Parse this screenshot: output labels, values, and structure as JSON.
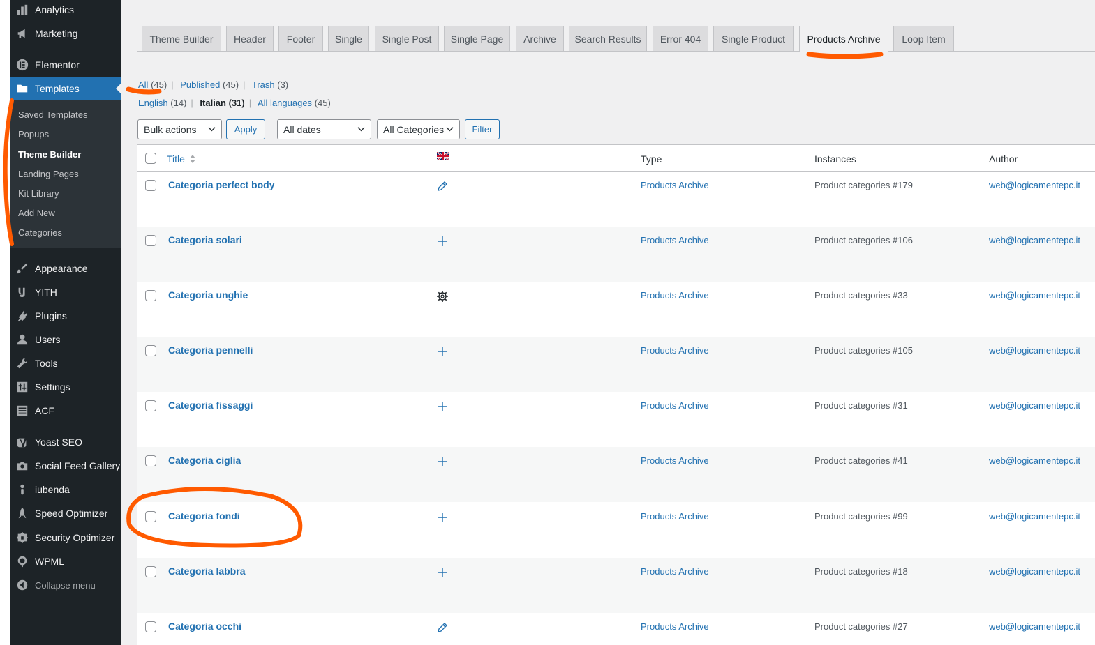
{
  "sidebar": {
    "items": [
      {
        "label": "Analytics",
        "icon": "bar-chart-icon"
      },
      {
        "label": "Marketing",
        "icon": "megaphone-icon"
      },
      {
        "label": "Elementor",
        "icon": "elementor-icon"
      },
      {
        "label": "Templates",
        "icon": "folder-icon"
      },
      {
        "label": "Appearance",
        "icon": "paintbrush-icon"
      },
      {
        "label": "YITH",
        "icon": "yith-icon"
      },
      {
        "label": "Plugins",
        "icon": "plug-icon"
      },
      {
        "label": "Users",
        "icon": "user-icon"
      },
      {
        "label": "Tools",
        "icon": "wrench-icon"
      },
      {
        "label": "Settings",
        "icon": "sliders-icon"
      },
      {
        "label": "ACF",
        "icon": "grid-icon"
      },
      {
        "label": "Yoast SEO",
        "icon": "yoast-icon"
      },
      {
        "label": "Social Feed Gallery",
        "icon": "camera-icon"
      },
      {
        "label": "iubenda",
        "icon": "iubenda-icon"
      },
      {
        "label": "Speed Optimizer",
        "icon": "rocket-icon"
      },
      {
        "label": "Security Optimizer",
        "icon": "lock-icon"
      },
      {
        "label": "WPML",
        "icon": "globe-icon"
      }
    ],
    "submenu": [
      "Saved Templates",
      "Popups",
      "Theme Builder",
      "Landing Pages",
      "Kit Library",
      "Add New",
      "Categories"
    ],
    "collapse": "Collapse menu"
  },
  "tabs": [
    "Theme Builder",
    "Header",
    "Footer",
    "Single",
    "Single Post",
    "Single Page",
    "Archive",
    "Search Results",
    "Error 404",
    "Single Product",
    "Products Archive",
    "Loop Item"
  ],
  "status_links": {
    "all": "All",
    "all_count": "(45)",
    "published": "Published",
    "published_count": "(45)",
    "trash": "Trash",
    "trash_count": "(3)"
  },
  "language_links": {
    "english": "English",
    "english_count": "(14)",
    "italian": "Italian (31)",
    "all": "All languages",
    "all_count": "(45)"
  },
  "filters": {
    "bulk": "Bulk actions",
    "apply": "Apply",
    "dates": "All dates",
    "categories": "All Categories",
    "filter": "Filter"
  },
  "table": {
    "headers": {
      "title": "Title",
      "type": "Type",
      "instances": "Instances",
      "author": "Author"
    },
    "flag_icon": "uk-flag-icon",
    "rows": [
      {
        "title": "Categoria perfect body",
        "lang_icon": "pencil-icon",
        "type": "Products Archive",
        "instances": "Product categories #179",
        "author": "web@logicamentepc.it"
      },
      {
        "title": "Categoria solari",
        "lang_icon": "plus-icon",
        "type": "Products Archive",
        "instances": "Product categories #106",
        "author": "web@logicamentepc.it"
      },
      {
        "title": "Categoria unghie",
        "lang_icon": "gear-icon",
        "type": "Products Archive",
        "instances": "Product categories #33",
        "author": "web@logicamentepc.it"
      },
      {
        "title": "Categoria pennelli",
        "lang_icon": "plus-icon",
        "type": "Products Archive",
        "instances": "Product categories #105",
        "author": "web@logicamentepc.it"
      },
      {
        "title": "Categoria fissaggi",
        "lang_icon": "plus-icon",
        "type": "Products Archive",
        "instances": "Product categories #31",
        "author": "web@logicamentepc.it"
      },
      {
        "title": "Categoria ciglia",
        "lang_icon": "plus-icon",
        "type": "Products Archive",
        "instances": "Product categories #41",
        "author": "web@logicamentepc.it"
      },
      {
        "title": "Categoria fondi",
        "lang_icon": "plus-icon",
        "type": "Products Archive",
        "instances": "Product categories #99",
        "author": "web@logicamentepc.it"
      },
      {
        "title": "Categoria labbra",
        "lang_icon": "plus-icon",
        "type": "Products Archive",
        "instances": "Product categories #18",
        "author": "web@logicamentepc.it"
      },
      {
        "title": "Categoria occhi",
        "lang_icon": "pencil-icon",
        "type": "Products Archive",
        "instances": "Product categories #27",
        "author": "web@logicamentepc.it"
      }
    ]
  },
  "colors": {
    "accent": "#2271b1",
    "sidebar": "#1d2327",
    "annotation": "#ff5a00"
  }
}
